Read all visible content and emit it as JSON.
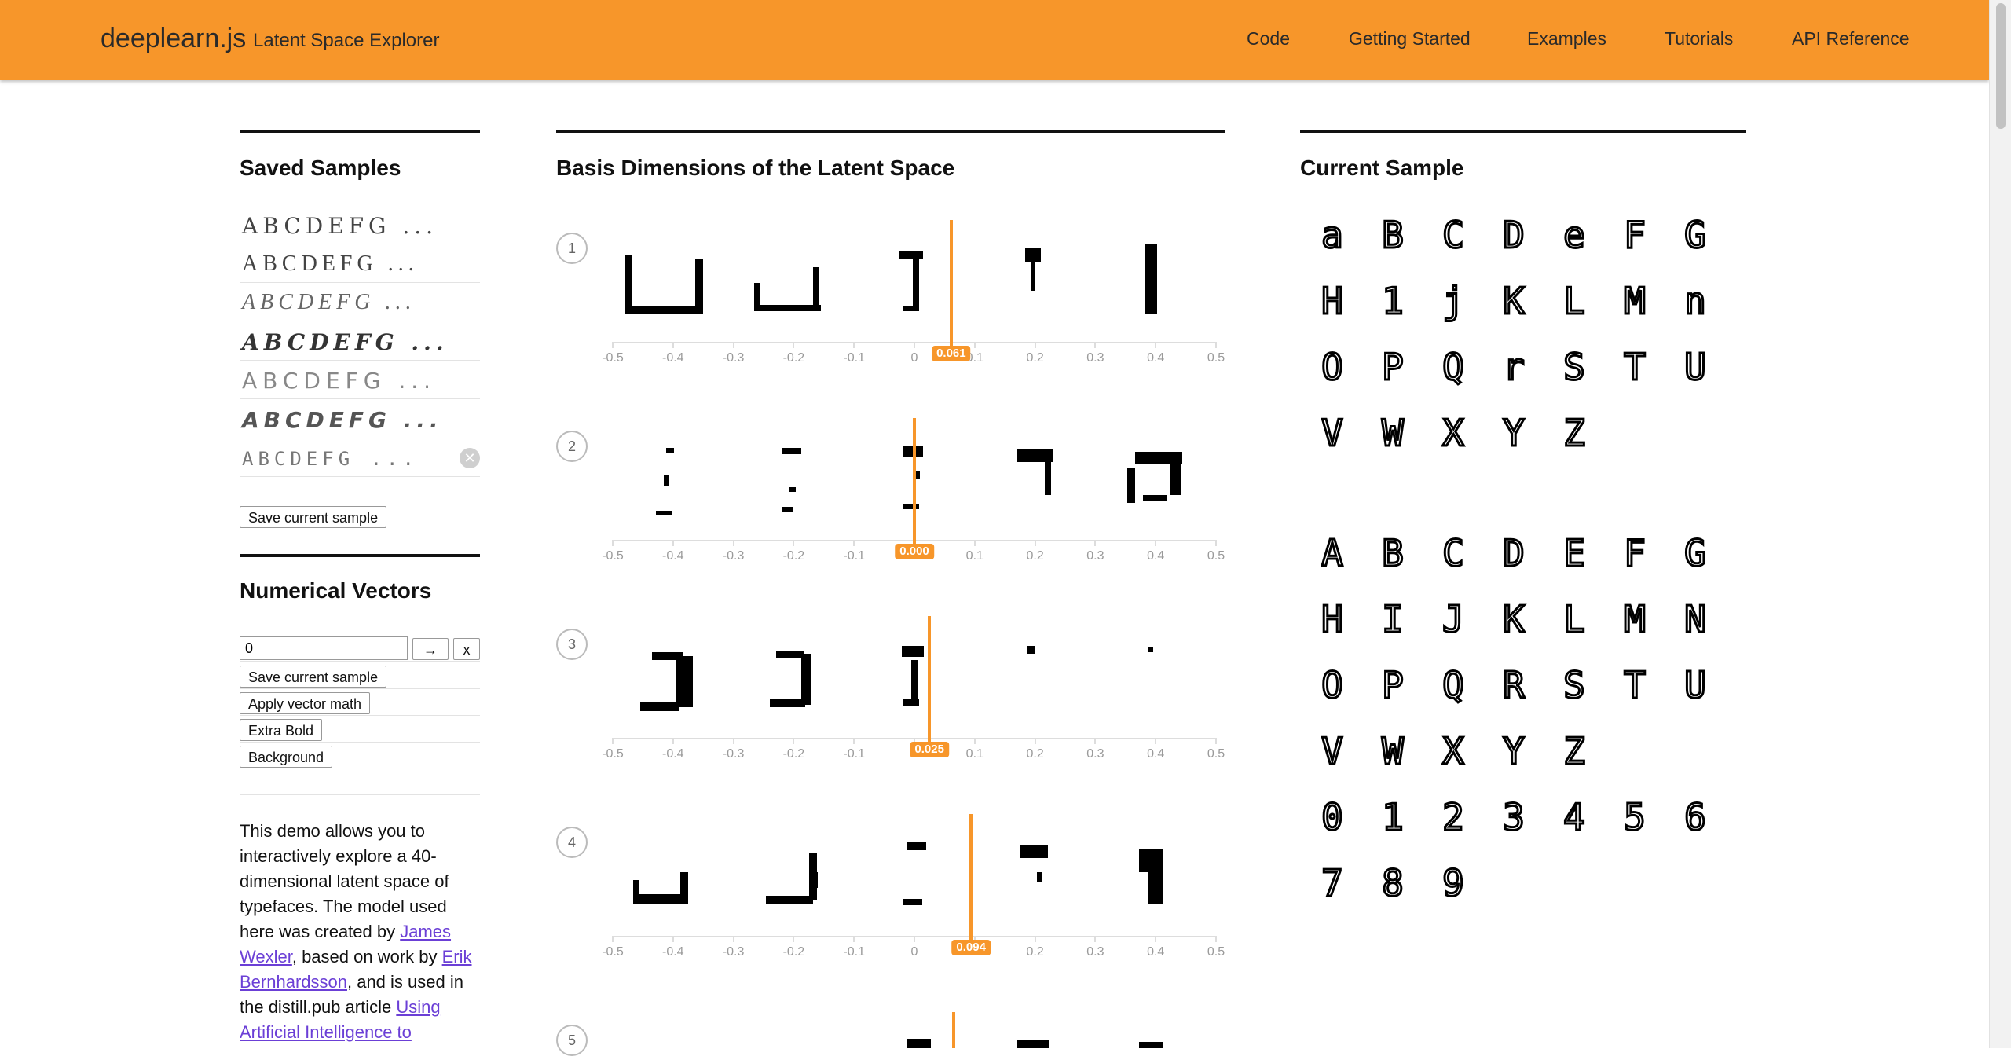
{
  "header": {
    "brand": "deeplearn.js",
    "subtitle": "Latent Space Explorer",
    "nav": [
      "Code",
      "Getting Started",
      "Examples",
      "Tutorials",
      "API Reference"
    ],
    "background_color": "#f7962a"
  },
  "saved_samples": {
    "title": "Saved Samples",
    "items": [
      "ABCDEFG ...",
      "ABCDEFG ...",
      "ABCDEFG ...",
      "ABCDEFG ...",
      "ABCDEFG ...",
      "ABCDEFG ...",
      "ABCDEFG ..."
    ],
    "remove_icon": "close-circle-icon",
    "save_button": "Save current sample"
  },
  "numerical_vectors": {
    "title": "Numerical Vectors",
    "input_value": "0",
    "arrow_button": "→",
    "clear_button": "x",
    "buttons": [
      "Save current sample",
      "Apply vector math",
      "Extra Bold",
      "Background"
    ]
  },
  "description": {
    "t1": "This demo allows you to interactively explore a 40-dimensional latent space of typefaces. The model used here was created by ",
    "link1": "James Wexler",
    "t2": ", based on work by ",
    "link2": "Erik Bernhardsson",
    "t3": ", and is used in the distill.pub article ",
    "link3": "Using Artificial Intelligence to"
  },
  "basis": {
    "title": "Basis Dimensions of the Latent Space",
    "ticks": [
      "-0.5",
      "-0.4",
      "-0.3",
      "-0.2",
      "-0.1",
      "0",
      "0.1",
      "0.2",
      "0.3",
      "0.4",
      "0.5"
    ],
    "dimensions": [
      {
        "index": "1",
        "value": 0.061,
        "label": "0.061"
      },
      {
        "index": "2",
        "value": 0.0,
        "label": "0.000"
      },
      {
        "index": "3",
        "value": 0.025,
        "label": "0.025"
      },
      {
        "index": "4",
        "value": 0.094,
        "label": "0.094"
      },
      {
        "index": "5",
        "value": 0.065,
        "label": ""
      }
    ],
    "accent_color": "#f7962a"
  },
  "current_sample": {
    "title": "Current Sample",
    "upper_rows": [
      [
        "a",
        "B",
        "C",
        "D",
        "e",
        "F",
        "G"
      ],
      [
        "H",
        "1",
        "j",
        "K",
        "L",
        "M",
        "n"
      ],
      [
        "O",
        "P",
        "Q",
        "r",
        "S",
        "T",
        "U"
      ],
      [
        "V",
        "W",
        "X",
        "Y",
        "Z"
      ]
    ],
    "lower_rows": [
      [
        "A",
        "B",
        "C",
        "D",
        "E",
        "F",
        "G"
      ],
      [
        "H",
        "I",
        "J",
        "K",
        "L",
        "M",
        "N"
      ],
      [
        "O",
        "P",
        "Q",
        "R",
        "S",
        "T",
        "U"
      ],
      [
        "V",
        "W",
        "X",
        "Y",
        "Z"
      ],
      [
        "0",
        "1",
        "2",
        "3",
        "4",
        "5",
        "6"
      ],
      [
        "7",
        "8",
        "9"
      ]
    ]
  }
}
